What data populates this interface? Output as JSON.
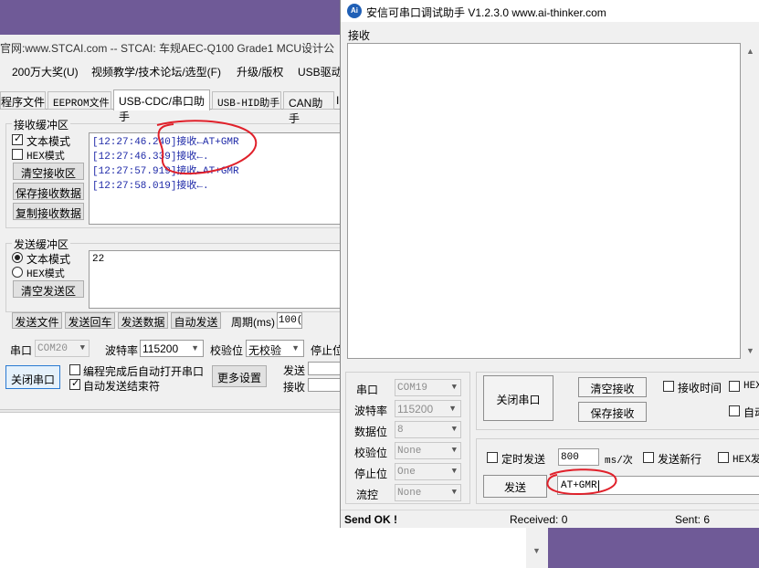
{
  "bg_window": {
    "title": "官网:www.STCAI.com  -- STCAI: 车规AEC-Q100 Grade1 MCU设计公",
    "menu": [
      "200万大奖(U)",
      "视频教学/技术论坛/选型(F)",
      "升级/版权",
      "USB驱动"
    ],
    "tabs": [
      "程序文件",
      "EEPROM文件",
      "USB-CDC/串口助手",
      "USB-HID助手",
      "CAN助手",
      "I"
    ],
    "recv_group": "接收缓冲区",
    "recv_text_mode": "文本模式",
    "recv_hex_mode": "HEX模式",
    "clear_recv": "清空接收区",
    "save_recv": "保存接收数据",
    "copy_recv": "复制接收数据",
    "recv_lines": [
      "[12:27:46.240]接收←AT+GMR",
      "[12:27:46.339]接收←.",
      "[12:27:57.919]接收←AT+GMR",
      "[12:27:58.019]接收←."
    ],
    "send_group": "发送缓冲区",
    "send_text_mode": "文本模式",
    "send_hex_mode": "HEX模式",
    "clear_send": "清空发送区",
    "send_content": "22",
    "send_file": "发送文件",
    "send_back": "发送回车",
    "send_data": "发送数据",
    "auto_send": "自动发送",
    "period_label": "周期(ms)",
    "period_value": "100(",
    "port_label": "串口",
    "port_value": "COM20",
    "baud_label": "波特率",
    "baud_value": "115200",
    "parity_label": "校验位",
    "parity_value": "无校验",
    "stop_label": "停止位",
    "close_port": "关闭串口",
    "auto_open": "编程完成后自动打开串口",
    "auto_send_end": "自动发送结束符",
    "more_settings": "更多设置",
    "send_stat": "发送",
    "recv_stat": "接收"
  },
  "fg_window": {
    "title": "安信可串口调试助手 V1.2.3.0     www.ai-thinker.com",
    "recv_label": "接收",
    "port_label": "串口",
    "port_value": "COM19",
    "baud_label": "波特率",
    "baud_value": "115200",
    "data_label": "数据位",
    "data_value": "8",
    "parity_label": "校验位",
    "parity_value": "None",
    "stop_label": "停止位",
    "stop_value": "One",
    "flow_label": "流控",
    "flow_value": "None",
    "close_port": "关闭串口",
    "clear_recv": "清空接收",
    "save_recv": "保存接收",
    "recv_time": "接收时间",
    "hex_show": "HEX",
    "auto_label": "自动",
    "timed_send": "定时发送",
    "interval_value": "800",
    "interval_unit": "ms/次",
    "send_newline": "发送新行",
    "hex_send": "HEX发",
    "send_button": "发送",
    "send_input": "AT+GMR",
    "status_ok": "Send OK !",
    "received": "Received: 0",
    "sent": "Sent: 6"
  },
  "colors": {
    "desktop": "#6f5a97",
    "recv_text": "#1f2aa8",
    "annotation": "#e0202a"
  }
}
